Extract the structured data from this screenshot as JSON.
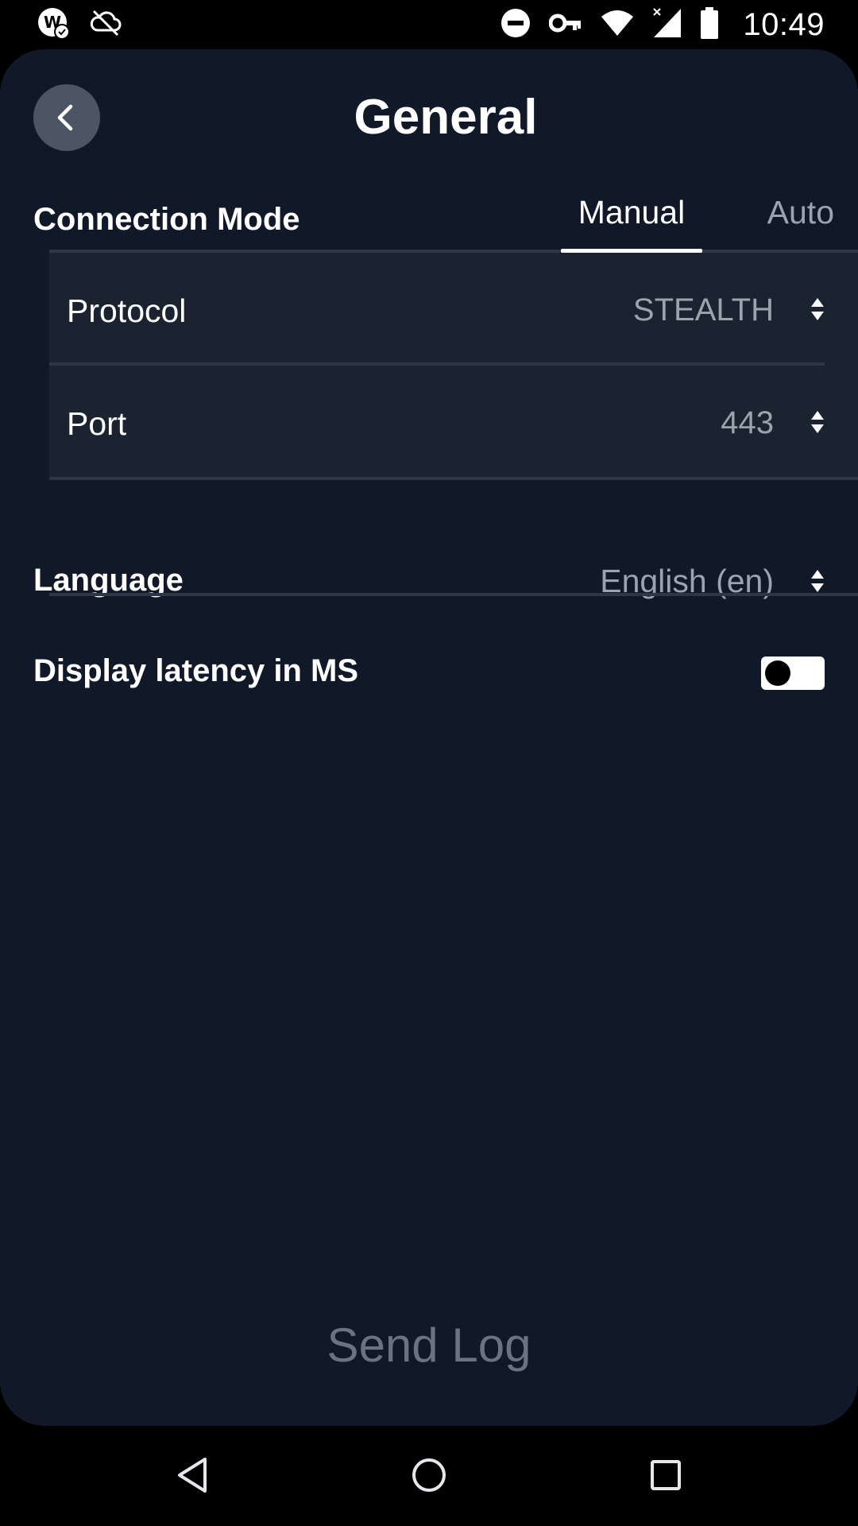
{
  "status_bar": {
    "time": "10:49",
    "icons_left": [
      "app-notification-icon",
      "cloud-off-icon"
    ],
    "icons_right": [
      "do-not-disturb-icon",
      "vpn-key-icon",
      "wifi-icon",
      "cell-signal-icon",
      "battery-icon"
    ]
  },
  "header": {
    "title": "General"
  },
  "connection_mode": {
    "label": "Connection Mode",
    "tabs": [
      {
        "label": "Manual",
        "selected": true
      },
      {
        "label": "Auto",
        "selected": false
      }
    ]
  },
  "manual_settings": {
    "protocol": {
      "label": "Protocol",
      "value": "STEALTH"
    },
    "port": {
      "label": "Port",
      "value": "443"
    }
  },
  "language": {
    "label": "Language",
    "value": "English (en)"
  },
  "latency": {
    "label": "Display latency in MS",
    "enabled": false
  },
  "footer": {
    "send_log_label": "Send Log"
  },
  "colors": {
    "background": "#111827",
    "sub_panel": "#1b2331",
    "divider": "#2e3746",
    "muted_text": "#9ca3af",
    "send_log_text": "#6b7280",
    "back_button": "#4b5563"
  }
}
